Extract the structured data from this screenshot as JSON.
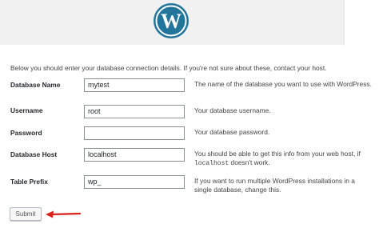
{
  "header": {
    "logo_icon": "wordpress-logo-icon",
    "logo_color": "#21759b"
  },
  "intro": "Below you should enter your database connection details. If you're not sure about these, contact your host.",
  "fields": [
    {
      "label": "Database Name",
      "value": "mytest",
      "hint": "The name of the database you want to use with WordPress."
    },
    {
      "label": "Username",
      "value": "root",
      "hint": "Your database username."
    },
    {
      "label": "Password",
      "value": "",
      "hint": "Your database password."
    },
    {
      "label": "Database Host",
      "value": "localhost",
      "hint_before": "You should be able to get this info from your web host, if ",
      "hint_code": "localhost",
      "hint_after": " doesn't work."
    },
    {
      "label": "Table Prefix",
      "value": "wp_",
      "hint": "If you want to run multiple WordPress installations in a single database, change this."
    }
  ],
  "submit": {
    "label": "Submit"
  },
  "annotation": {
    "arrow_icon": "red-arrow-icon",
    "color": "#d9231d"
  }
}
